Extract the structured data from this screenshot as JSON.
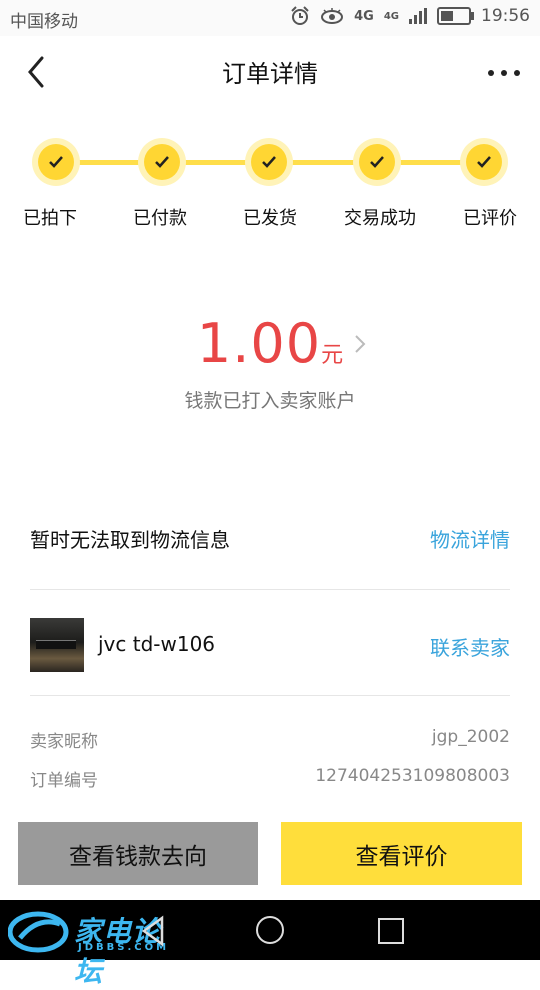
{
  "status_bar": {
    "carrier": "中国移动",
    "network_1": "4G",
    "network_2": "4G",
    "time": "19:56"
  },
  "header": {
    "title": "订单详情"
  },
  "steps": [
    {
      "label": "已拍下",
      "done": true
    },
    {
      "label": "已付款",
      "done": true
    },
    {
      "label": "已发货",
      "done": true
    },
    {
      "label": "交易成功",
      "done": true
    },
    {
      "label": "已评价",
      "done": true
    }
  ],
  "amount": {
    "value": "1.00",
    "unit": "元",
    "description": "钱款已打入卖家账户"
  },
  "logistics": {
    "text": "暂时无法取到物流信息",
    "link": "物流详情"
  },
  "product": {
    "name": "jvc td-w106",
    "contact": "联系卖家"
  },
  "info": [
    {
      "label": "卖家昵称",
      "value": "jgp_2002"
    },
    {
      "label": "订单编号",
      "value": "127404253109808003"
    }
  ],
  "buttons": {
    "left": "查看钱款去向",
    "right": "查看评价"
  },
  "watermark": {
    "text": "家电论坛",
    "sub": "JDBBS.COM"
  },
  "colors": {
    "accent_yellow": "#ffd633",
    "price_red": "#e84646",
    "link_blue": "#3aa4dc"
  }
}
